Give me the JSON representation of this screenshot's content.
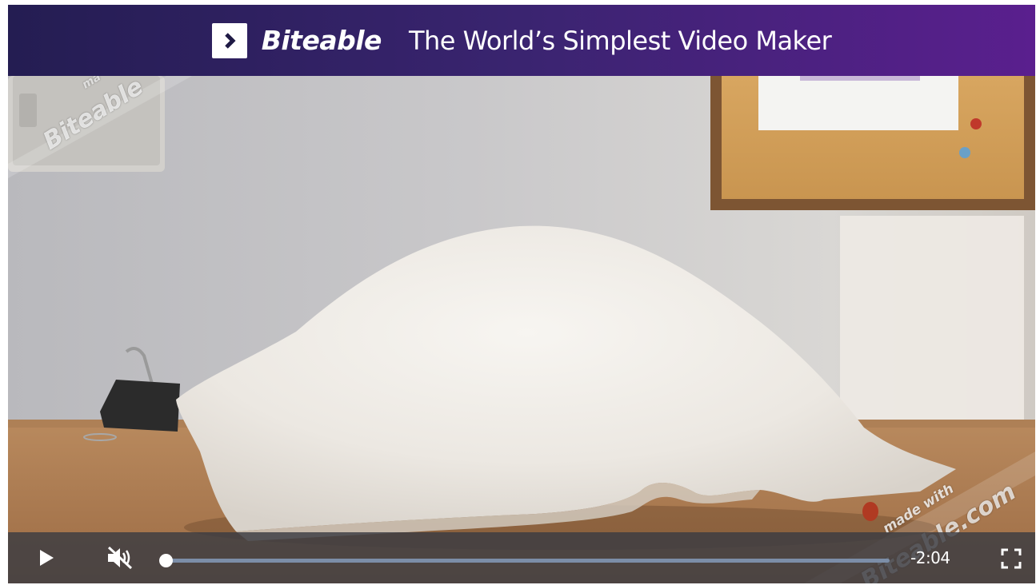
{
  "banner": {
    "brand": "Biteable",
    "tagline": "The World’s Simplest Video Maker",
    "colors": {
      "start": "#241d52",
      "end": "#5a1f8e"
    },
    "logo_icon": "chevron-right-icon"
  },
  "video": {
    "watermark_small": "made with",
    "watermark_brand_top": "Biteable",
    "watermark_brand_bottom": "Biteable.com"
  },
  "controls": {
    "play_icon": "play-icon",
    "mute_icon": "volume-muted-icon",
    "progress_fraction": 0.0,
    "time_remaining": "-2:04",
    "fullscreen_icon": "fullscreen-icon"
  }
}
